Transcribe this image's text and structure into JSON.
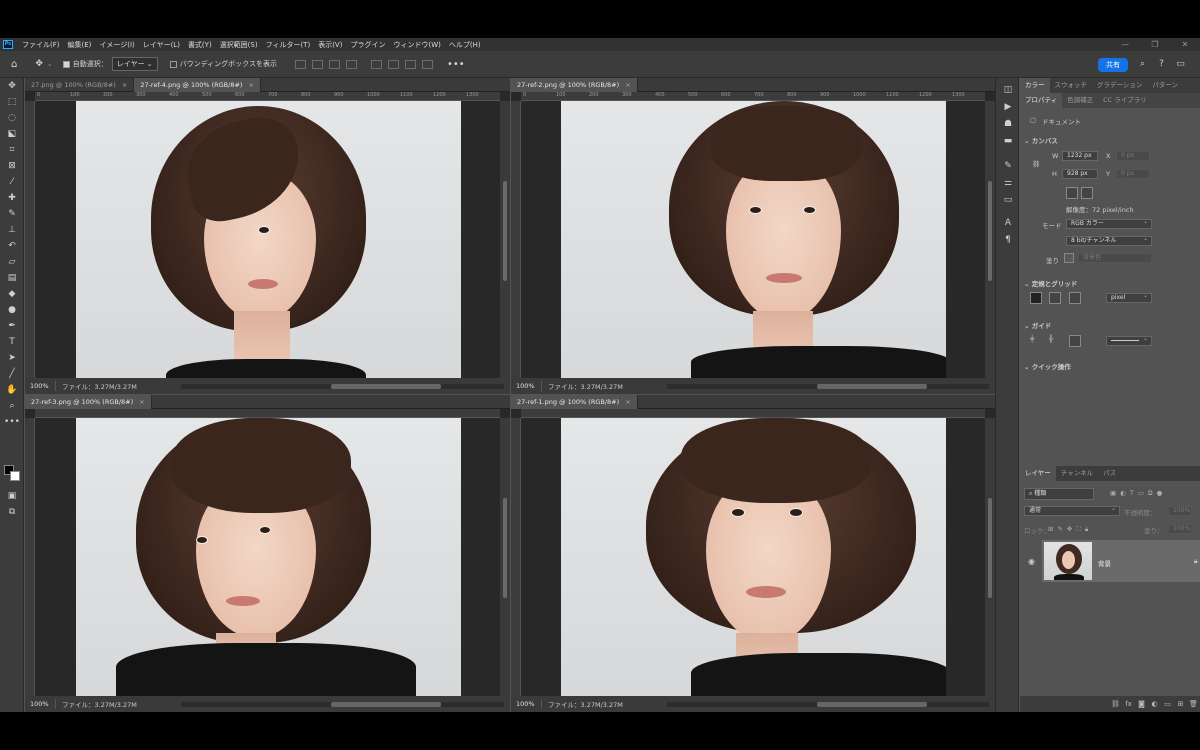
{
  "menu": [
    "ファイル(F)",
    "編集(E)",
    "イメージ(I)",
    "レイヤー(L)",
    "書式(Y)",
    "選択範囲(S)",
    "フィルター(T)",
    "表示(V)",
    "プラグイン",
    "ウィンドウ(W)",
    "ヘルプ(H)"
  ],
  "options": {
    "auto_select": "自動選択：",
    "auto_select_target": "レイヤー",
    "bounding_box": "バウンディングボックスを表示",
    "share": "共有"
  },
  "panes": [
    {
      "tabs": [
        {
          "title": "27.png @ 100% (RGB/8#)",
          "active": false
        },
        {
          "title": "27-ref-4.png @ 100% (RGB/8#)",
          "active": true
        }
      ],
      "zoom": "100%",
      "file": "ファイル：3.27M/3.27M"
    },
    {
      "tabs": [
        {
          "title": "27-ref-2.png @ 100% (RGB/8#)",
          "active": false
        }
      ],
      "zoom": "100%",
      "file": "ファイル：3.27M/3.27M"
    },
    {
      "tabs": [
        {
          "title": "27-ref-3.png @ 100% (RGB/8#)",
          "active": false
        }
      ],
      "zoom": "100%",
      "file": "ファイル：3.27M/3.27M"
    },
    {
      "tabs": [
        {
          "title": "27-ref-1.png @ 100% (RGB/8#)",
          "active": false
        }
      ],
      "zoom": "100%",
      "file": "ファイル：3.27M/3.27M"
    }
  ],
  "ruler_numbers": [
    "0",
    "100",
    "200",
    "300",
    "400",
    "500",
    "600",
    "700",
    "800",
    "900",
    "1000",
    "1100",
    "1200",
    "1300"
  ],
  "right_panel": {
    "top_tabs": [
      "カラー",
      "スウォッチ",
      "グラデーション",
      "パターン"
    ],
    "prop_tabs": [
      "プロパティ",
      "色調補正",
      "CC ライブラリ"
    ],
    "document_label": "ドキュメント",
    "canvas_title": "カンバス",
    "w_label": "W",
    "w_value": "1232 px",
    "h_label": "H",
    "h_value": "928 px",
    "x_label": "X",
    "x_value": "0 px",
    "y_label": "Y",
    "y_value": "0 px",
    "resolution": "解像度：72 pixel/inch",
    "mode_label": "モード",
    "mode_value": "RGB カラー",
    "bit_value": "8 bit/チャンネル",
    "fill_label": "塗り",
    "fill_value": "背景色",
    "rulers_title": "定規とグリッド",
    "unit_value": "pixel",
    "guides_title": "ガイド",
    "quick_title": "クイック操作",
    "layer_tabs": [
      "レイヤー",
      "チャンネル",
      "パス"
    ],
    "search_placeholder": "種類",
    "blend_mode": "通常",
    "opacity_label": "不透明度：",
    "opacity_value": "100%",
    "lock_label": "ロック：",
    "fill2_label": "塗り：",
    "fill2_value": "100%",
    "layer_name": "背景"
  }
}
